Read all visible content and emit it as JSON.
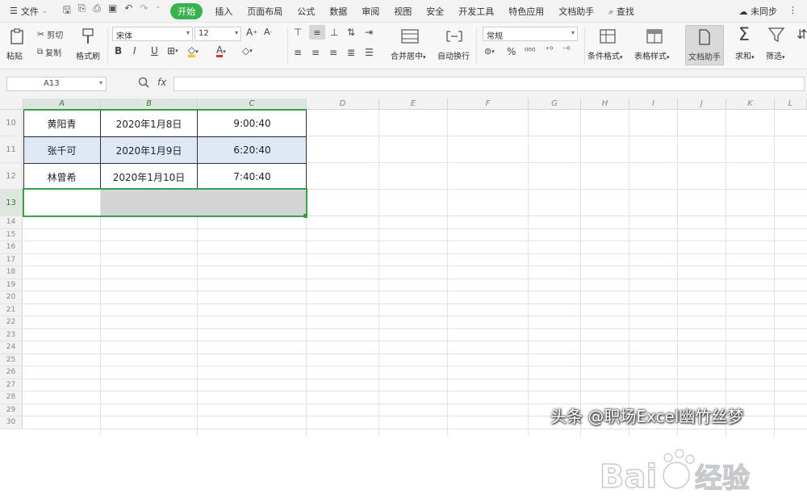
{
  "menubar": {
    "file_label": "文件",
    "tabs": [
      "开始",
      "插入",
      "页面布局",
      "公式",
      "数据",
      "审阅",
      "视图",
      "安全",
      "开发工具",
      "特色应用",
      "文档助手"
    ],
    "active_tab": "开始",
    "search_label": "查找",
    "sync_label": "未同步",
    "colors": {
      "active": "#37b24d"
    }
  },
  "ribbon": {
    "paste": "粘贴",
    "cut": "剪切",
    "copy": "复制",
    "format_painter": "格式刷",
    "font_name": "宋体",
    "font_size": "12",
    "merge_center": "合并居中",
    "wrap_text": "自动换行",
    "number_format": "常规",
    "conditional_format": "条件格式",
    "table_style": "表格样式",
    "doc_helper": "文档助手",
    "sum": "求和",
    "filter": "筛选"
  },
  "formula_bar": {
    "cell_ref": "A13",
    "fx": "fx",
    "value": ""
  },
  "sheet": {
    "columns": [
      "A",
      "B",
      "C",
      "D",
      "E",
      "F",
      "G",
      "H",
      "I",
      "J",
      "K",
      "L"
    ],
    "rows_big": [
      "10",
      "11",
      "12",
      "13"
    ],
    "rows_small": [
      "14",
      "15",
      "16",
      "17",
      "18",
      "19",
      "20",
      "21",
      "22",
      "23",
      "24",
      "25",
      "26",
      "27",
      "28",
      "29",
      "30"
    ],
    "data": [
      [
        "黄阳青",
        "2020年1月8日",
        "9:00:40"
      ],
      [
        "张千可",
        "2020年1月9日",
        "6:20:40"
      ],
      [
        "林曾希",
        "2020年1月10日",
        "7:40:40"
      ]
    ],
    "colors": {
      "selection": "#37a048",
      "highlight_row": "#dde8f4",
      "gray_cell": "#d4d4d4"
    }
  },
  "overlay": {
    "caption": "头条 @职场Excel幽竹丝梦",
    "watermark": "Baidu 经验"
  }
}
